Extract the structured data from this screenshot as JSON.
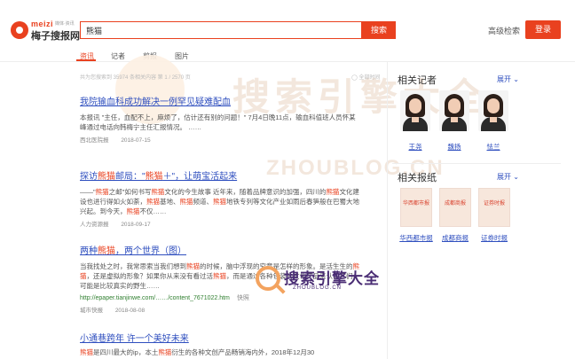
{
  "header": {
    "logo_brand": "meizi",
    "logo_tag": "媒体·资讯",
    "logo_name": "梅子搜报网",
    "search_value": "熊猫",
    "search_button": "搜索",
    "advanced_search": "高级检索",
    "login": "登录"
  },
  "tabs": [
    {
      "label": "资讯",
      "active": true
    },
    {
      "label": "记者",
      "active": false
    },
    {
      "label": "剪报",
      "active": false
    },
    {
      "label": "图片",
      "active": false
    }
  ],
  "watermark": {
    "text": "搜索引擎大全",
    "sub": "ZHOUBLOG.CN",
    "text2": "搜索引擎大全",
    "sub2": "ZHOUBLOG.CN"
  },
  "results_stats": "共为您搜索到 35974 条相关内容   第 1 / 2570 页",
  "doc_filter": "◯ 全部时间",
  "results": [
    {
      "title_parts": [
        {
          "t": "我院输血科成功解决一例罕见疑难配血"
        }
      ],
      "body_parts": [
        {
          "t": "本报讯 \"主任，血配不上，麻烦了，估计还有别的问题！\" 7月4日晚11点，输血科值班人员怀某峰通过电话向韩梅宁主任汇报情况。 ……"
        }
      ],
      "source": "西北医院报",
      "date": "2018-07-15",
      "link": ""
    },
    {
      "title_parts": [
        {
          "t": "探访"
        },
        {
          "t": "熊猫",
          "hl": true
        },
        {
          "t": "邮局：\""
        },
        {
          "t": "熊猫",
          "hl": true
        },
        {
          "t": "＋\"，让萌宝活起来"
        }
      ],
      "body_parts": [
        {
          "t": "——\""
        },
        {
          "t": "熊猫",
          "hl": true
        },
        {
          "t": "之邮\"如何书写"
        },
        {
          "t": "熊猫",
          "hl": true
        },
        {
          "t": "文化的今生故事 近年来，随着品牌意识的加强，四川的"
        },
        {
          "t": "熊猫",
          "hl": true
        },
        {
          "t": "文化建设也进行得如火如荼，"
        },
        {
          "t": "熊猫",
          "hl": true
        },
        {
          "t": "基地、"
        },
        {
          "t": "熊猫",
          "hl": true
        },
        {
          "t": "频道、"
        },
        {
          "t": "熊猫",
          "hl": true
        },
        {
          "t": "地铁专列等文化产业如雨后春笋般在巴蜀大地兴起。到今天，"
        },
        {
          "t": "熊猫",
          "hl": true
        },
        {
          "t": "不仅……"
        }
      ],
      "source": "人力资源报",
      "date": "2018-09-17",
      "link": ""
    },
    {
      "title_parts": [
        {
          "t": "两种"
        },
        {
          "t": "熊猫",
          "hl": true
        },
        {
          "t": "，两个世界（图）"
        }
      ],
      "body_parts": [
        {
          "t": "当我找处之时，我常思索当我们想到"
        },
        {
          "t": "熊猫",
          "hl": true
        },
        {
          "t": "的时候，脑中浮现的究竟是怎样的形象。是活生生的"
        },
        {
          "t": "熊猫",
          "hl": true
        },
        {
          "t": "，还是虚拟的形象？如果你从来没有看过活"
        },
        {
          "t": "熊猫",
          "hl": true
        },
        {
          "t": "，而是通过各种包装的文化产品来认识它们，可能是比较真实的野生……"
        }
      ],
      "source": "城市快报",
      "date": "2018-08-08",
      "link": "http://epaper.tianjinwe.com/……/content_7671022.htm",
      "snapshot": "快照"
    },
    {
      "title_parts": [
        {
          "t": "小通巷跨年 许一个美好未来"
        }
      ],
      "body_parts": [
        {
          "t": "熊猫",
          "hl": true
        },
        {
          "t": "是四川最大的ip，本土"
        },
        {
          "t": "熊猫",
          "hl": true
        },
        {
          "t": "衍生的各种文创产品畅销海内外，2018年12月30"
        }
      ],
      "source": "",
      "date": "",
      "link": ""
    }
  ],
  "sidebar": {
    "reporters_title": "相关记者",
    "more": "展开",
    "reporters": [
      {
        "name": "王尧"
      },
      {
        "name": "魏扬"
      },
      {
        "name": "怯兰"
      }
    ],
    "papers_title": "相关报纸",
    "papers": [
      {
        "masthead": "华西都市报",
        "name": "华西都市报"
      },
      {
        "masthead": "成都商报",
        "name": "成都商报"
      },
      {
        "masthead": "证券时报",
        "name": "证券时报"
      }
    ]
  },
  "colors": {
    "accent": "#e9411f",
    "link": "#2f4fbf",
    "url": "#2f7f2f"
  }
}
